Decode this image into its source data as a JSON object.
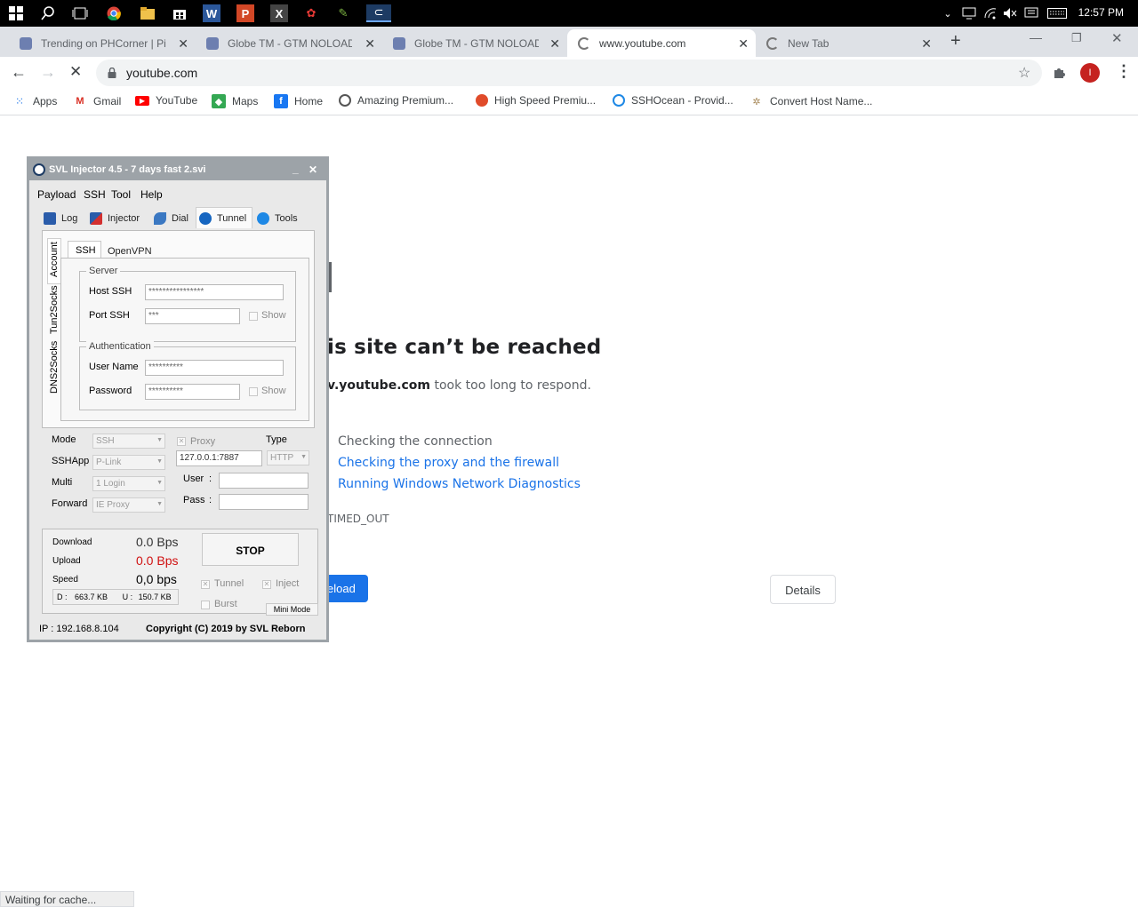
{
  "taskbar": {
    "clock": "12:57 PM",
    "icons": [
      "windows-start-icon",
      "search-icon",
      "task-view-icon",
      "chrome-icon",
      "file-explorer-icon",
      "store-icon",
      "word-icon",
      "powerpoint-icon",
      "excel-icon",
      "app-icon",
      "app-icon-2",
      "svl-icon"
    ]
  },
  "tabs": [
    {
      "title": "Trending on PHCorner | Pin..."
    },
    {
      "title": "Globe TM - GTM NOLOAD..."
    },
    {
      "title": "Globe TM - GTM NOLOAD..."
    },
    {
      "title": "www.youtube.com"
    },
    {
      "title": "New Tab"
    }
  ],
  "address": {
    "url": "youtube.com",
    "profile_initial": "I"
  },
  "bookmarks": [
    "Apps",
    "Gmail",
    "YouTube",
    "Maps",
    "Home",
    "Amazing Premium...",
    "High Speed Premiu...",
    "SSHOcean - Provid...",
    "Convert Host Name..."
  ],
  "error_page": {
    "heading": "is site can’t be reached",
    "domain": "v.youtube.com",
    "message": " took too long to respond.",
    "try_items": [
      "Checking the connection",
      "Checking the proxy and the firewall",
      "Running Windows Network Diagnostics"
    ],
    "error_code": "TIMED_OUT",
    "reload_label": "eload",
    "details_label": "Details"
  },
  "status_bar": "Waiting for cache...",
  "svl": {
    "title": "SVL Injector 4.5 - 7 days fast 2.svi",
    "menu": [
      "Payload",
      "SSH",
      "Tool",
      "Help"
    ],
    "tabs": [
      "Log",
      "Injector",
      "Dial",
      "Tunnel",
      "Tools"
    ],
    "side_tabs": [
      "Account",
      "Tun2Socks",
      "DNS2Socks"
    ],
    "sub_tabs": [
      "SSH",
      "OpenVPN"
    ],
    "server": {
      "label": "Server",
      "host_label": "Host SSH",
      "host_value": "****************",
      "port_label": "Port SSH",
      "port_value": "***",
      "show_label": "Show"
    },
    "auth": {
      "label": "Authentication",
      "user_label": "User Name",
      "user_value": "**********",
      "pass_label": "Password",
      "pass_value": "**********",
      "show_label": "Show"
    },
    "mode_label": "Mode",
    "mode_value": "SSH",
    "sshapp_label": "SSHApp",
    "sshapp_value": "P-Link",
    "multi_label": "Multi",
    "multi_value": "1 Login",
    "forward_label": "Forward",
    "forward_value": "IE Proxy",
    "proxy_label": "Proxy",
    "proxy_value": "127.0.0.1:7887",
    "type_label": "Type",
    "type_value": "HTTP",
    "user_label": "User",
    "pass_label": "Pass",
    "colon": ":",
    "stats": {
      "download_label": "Download",
      "download_value": "0.0 Bps",
      "upload_label": "Upload",
      "upload_value": "0.0 Bps",
      "speed_label": "Speed",
      "speed_value": "0,0 bps",
      "d_label": "D :",
      "d_value": "663.7 KB",
      "u_label": "U :",
      "u_value": "150.7 KB"
    },
    "stop_label": "STOP",
    "tunnel_label": "Tunnel",
    "inject_label": "Inject",
    "burst_label": "Burst",
    "mini_mode_label": "Mini Mode",
    "ip_label": "IP : 192.168.8.104",
    "copyright": "Copyright (C) 2019 by SVL Reborn"
  },
  "colors": {
    "link": "#1a73e8",
    "error_blue": "#1a73e8",
    "upload_red": "#d01010"
  }
}
